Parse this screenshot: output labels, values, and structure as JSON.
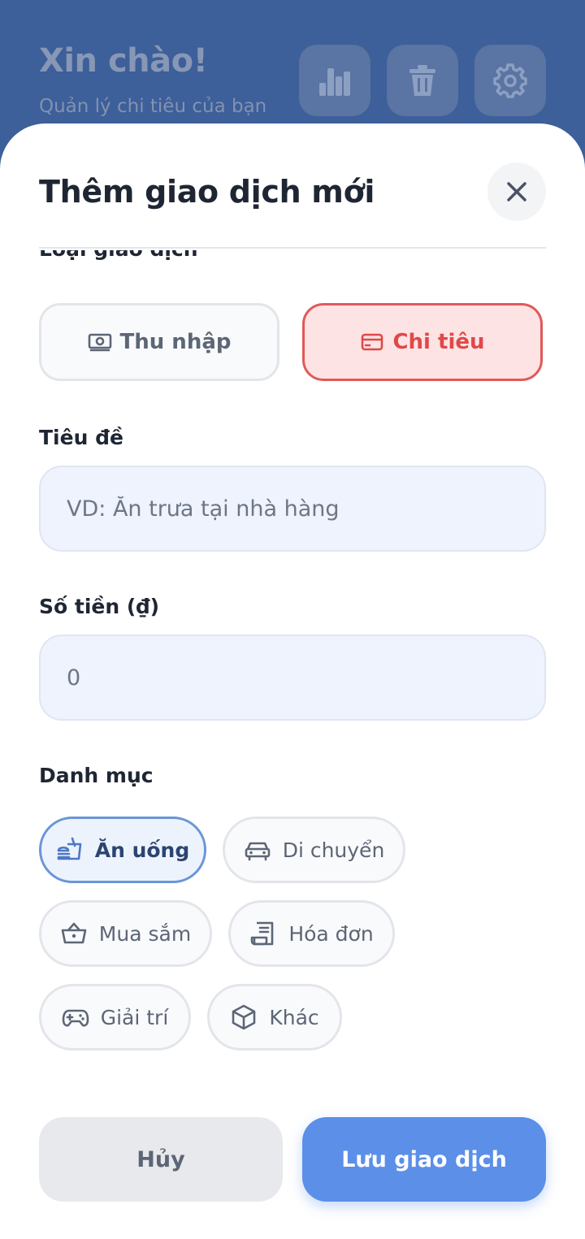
{
  "header": {
    "greeting": "Xin chào!",
    "subtitle": "Quản lý chi tiêu của bạn",
    "actions": [
      {
        "icon": "bar-chart-icon"
      },
      {
        "icon": "trash-icon"
      },
      {
        "icon": "gear-icon"
      }
    ]
  },
  "modal": {
    "title": "Thêm giao dịch mới",
    "type_label": "Loại giao dịch",
    "types": {
      "income": {
        "label": "Thu nhập",
        "icon": "money-icon",
        "selected": false
      },
      "expense": {
        "label": "Chi tiêu",
        "icon": "credit-card-icon",
        "selected": true
      }
    },
    "title_field": {
      "label": "Tiêu đề",
      "value": "",
      "placeholder": "VD: Ăn trưa tại nhà hàng"
    },
    "amount_field": {
      "label": "Số tiền (₫)",
      "value": "",
      "placeholder": "0"
    },
    "category": {
      "label": "Danh mục",
      "selected": "Ăn uống",
      "items": [
        {
          "label": "Ăn uống",
          "icon": "food-icon"
        },
        {
          "label": "Di chuyển",
          "icon": "car-icon"
        },
        {
          "label": "Mua sắm",
          "icon": "basket-icon"
        },
        {
          "label": "Hóa đơn",
          "icon": "receipt-icon"
        },
        {
          "label": "Giải trí",
          "icon": "gamepad-icon"
        },
        {
          "label": "Khác",
          "icon": "box-icon"
        }
      ]
    },
    "buttons": {
      "cancel": "Hủy",
      "save": "Lưu giao dịch"
    }
  },
  "colors": {
    "header_bg": "#3d5f9a",
    "accent": "#5b8fe8",
    "expense": "#e04848",
    "input_bg": "#eef3fd"
  }
}
